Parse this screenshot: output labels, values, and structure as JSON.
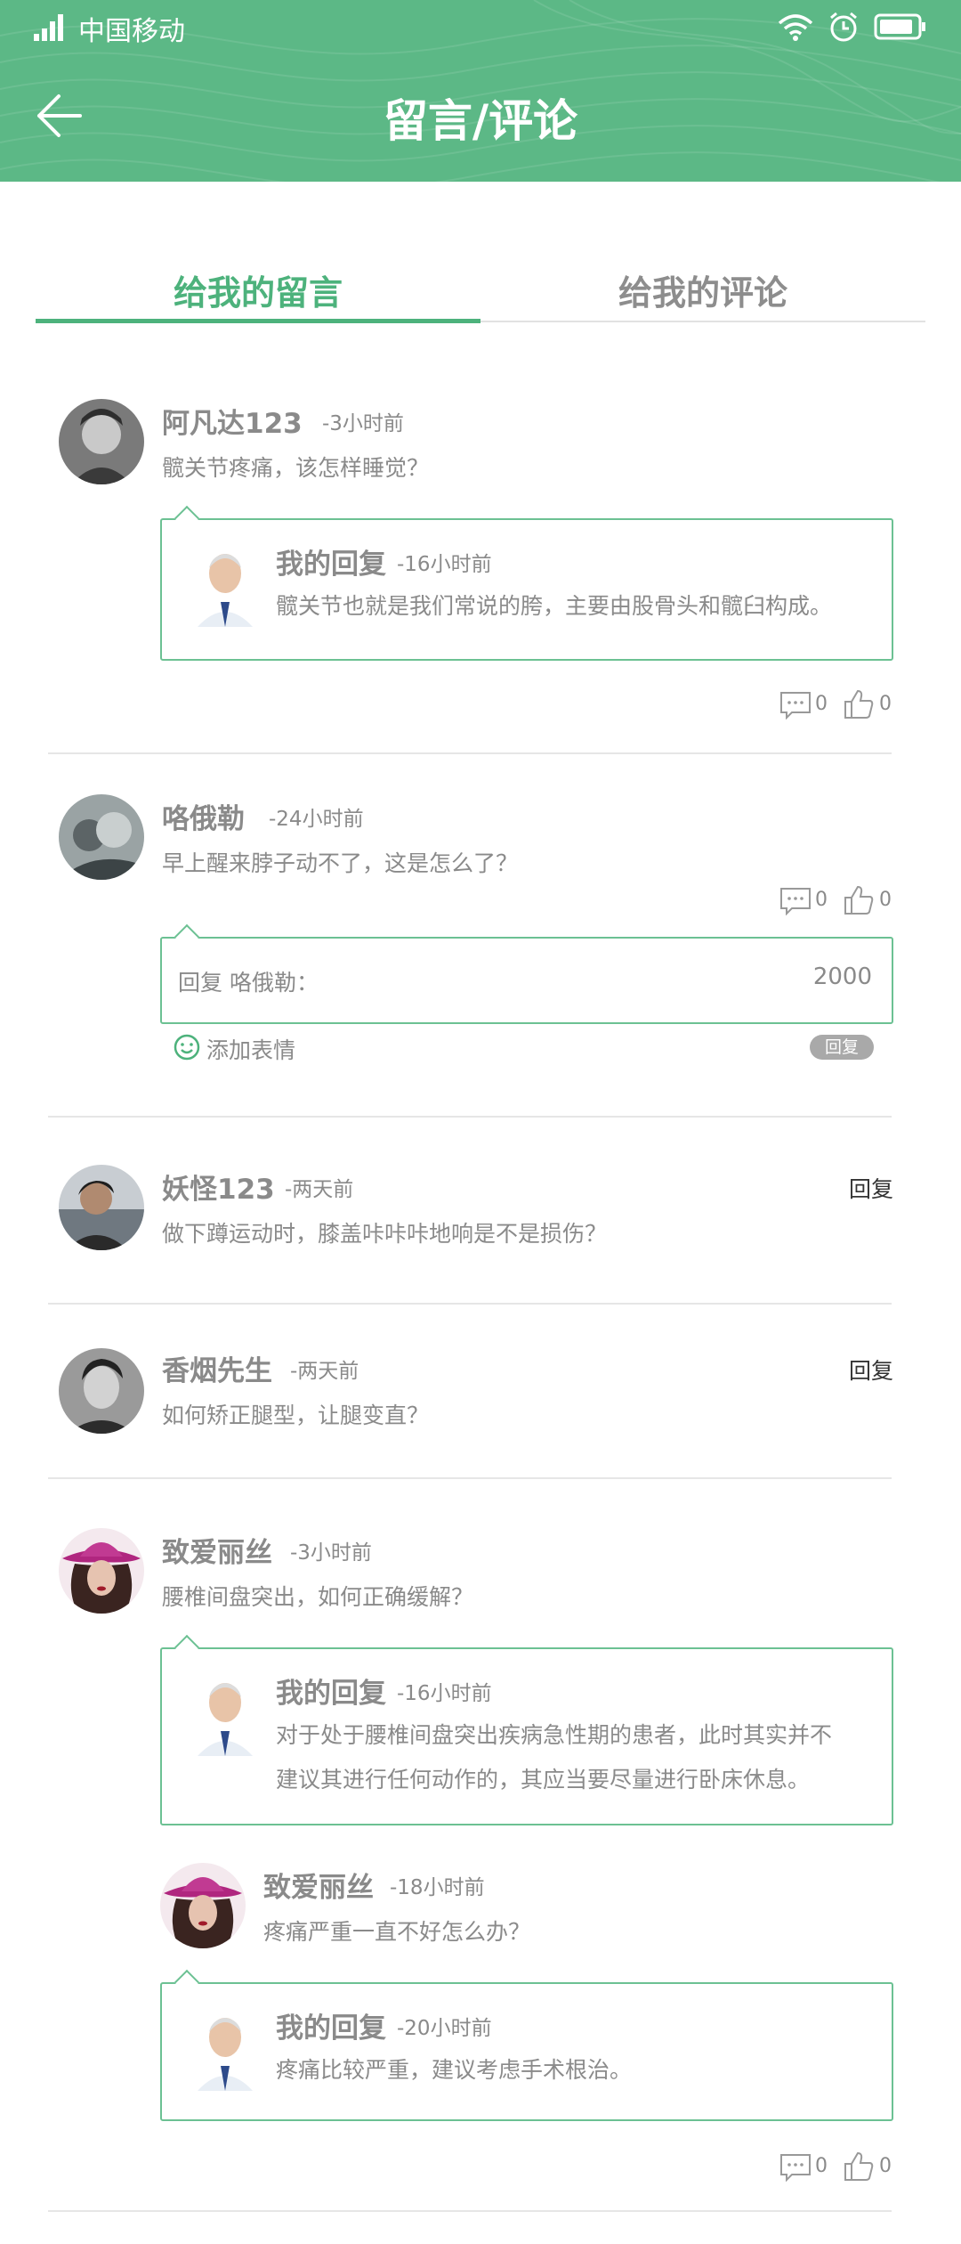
{
  "status_bar": {
    "carrier": "中国移动"
  },
  "header": {
    "title": "留言/评论"
  },
  "tabs": [
    {
      "label": "给我的留言"
    },
    {
      "label": "给我的评论"
    }
  ],
  "messages": [
    {
      "user": "阿凡达123",
      "time": "-3小时前",
      "text": "髋关节疼痛，该怎样睡觉？",
      "reply": {
        "user": "我的回复",
        "time": "-16小时前",
        "lines": [
          "髋关节也就是我们常说的胯，主要由股骨头和髋臼构成。"
        ]
      },
      "comments": "0",
      "likes": "0"
    },
    {
      "user": "咯俄勒",
      "time": "-24小时前",
      "text": "早上醒来脖子动不了，这是怎么了？",
      "comments": "0",
      "likes": "0",
      "reply_input": {
        "placeholder": "回复 咯俄勒：",
        "char_limit": "2000"
      },
      "emoji_label": "添加表情",
      "reply_button": "回复"
    },
    {
      "user": "妖怪123",
      "time": "-两天前",
      "text": "做下蹲运动时，膝盖咔咔咔地响是不是损伤？",
      "reply_link": "回复"
    },
    {
      "user": "香烟先生",
      "time": "-两天前",
      "text": "如何矫正腿型，让腿变直？",
      "reply_link": "回复"
    },
    {
      "user": "致爱丽丝",
      "time": "-3小时前",
      "text": "腰椎间盘突出，如何正确缓解？",
      "reply": {
        "user": "我的回复",
        "time": "-16小时前",
        "lines": [
          "对于处于腰椎间盘突出疾病急性期的患者，此时其实并不",
          "建议其进行任何动作的，其应当要尽量进行卧床休息。"
        ]
      },
      "followup": {
        "user": "致爱丽丝",
        "time": "-18小时前",
        "text": "疼痛严重一直不好怎么办？",
        "reply": {
          "user": "我的回复",
          "time": "-20小时前",
          "lines": [
            "疼痛比较严重，建议考虑手术根治。"
          ]
        }
      },
      "comments": "0",
      "likes": "0"
    }
  ],
  "colors": {
    "header_green": "#5cb886",
    "accent_green": "#4db27c",
    "box_border": "#6cc193"
  }
}
